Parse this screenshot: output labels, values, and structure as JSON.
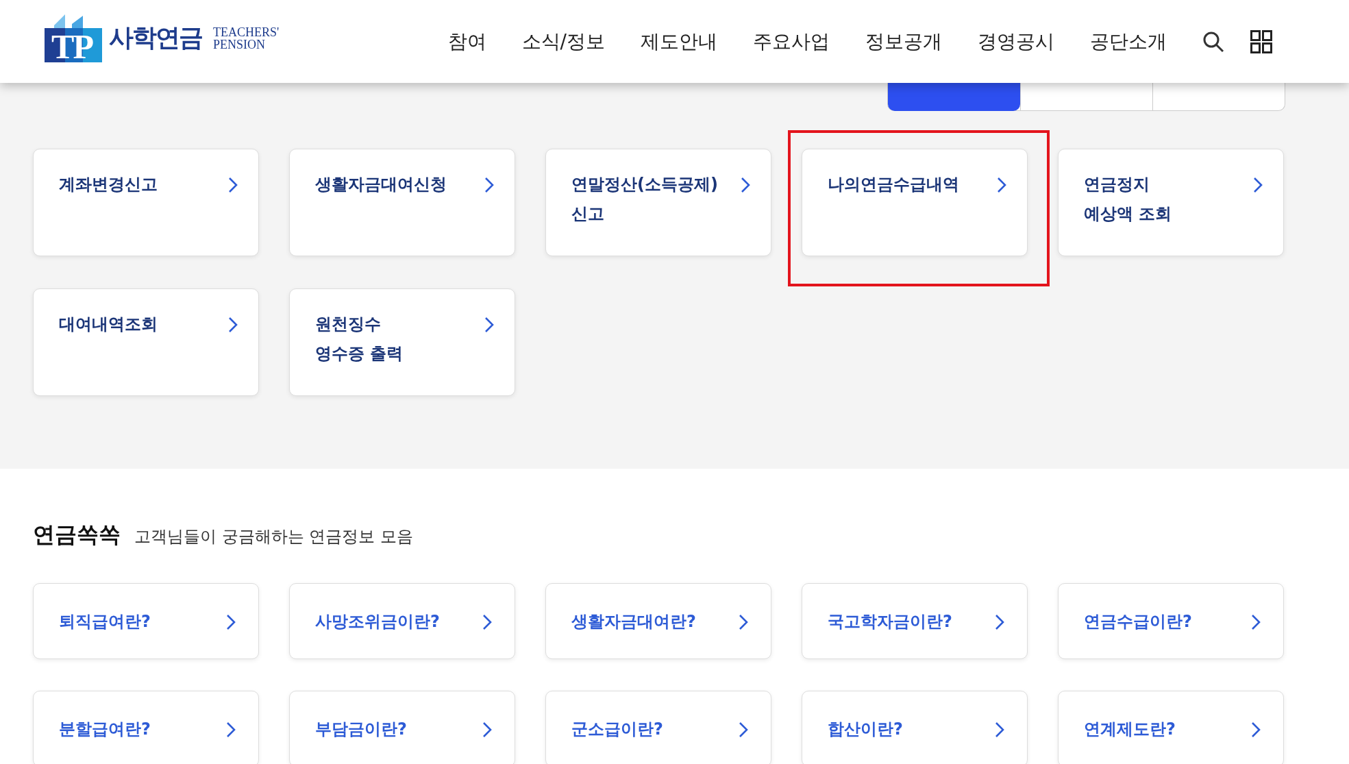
{
  "header": {
    "logo": {
      "mark": "TP",
      "name": "사학연금",
      "english_lines": [
        "TEACHERS'",
        "PENSION"
      ]
    },
    "nav": [
      "참여",
      "소식/정보",
      "제도안내",
      "주요사업",
      "정보공개",
      "경영공시",
      "공단소개"
    ]
  },
  "quick_menu": {
    "tabs": [
      {
        "selected": true
      },
      {
        "selected": false
      },
      {
        "selected": false
      }
    ],
    "cards": [
      {
        "label": "계좌변경신고",
        "highlighted": false
      },
      {
        "label": "생활자금대여신청",
        "highlighted": false
      },
      {
        "label": "연말정산(소득공제)\n신고",
        "highlighted": false
      },
      {
        "label": "나의연금수급내역",
        "highlighted": true
      },
      {
        "label": "연금정지\n예상액 조회",
        "highlighted": false
      },
      {
        "label": "대여내역조회",
        "highlighted": false
      },
      {
        "label": "원천징수\n영수증 출력",
        "highlighted": false
      }
    ]
  },
  "faq": {
    "title": "연금쏙쏙",
    "subtitle": "고객님들이 궁금해하는 연금정보 모음",
    "cards": [
      "퇴직급여란?",
      "사망조위금이란?",
      "생활자금대여란?",
      "국고학자금이란?",
      "연금수급이란?",
      "분할급여란?",
      "부담금이란?",
      "군소급이란?",
      "합산이란?",
      "연계제도란?"
    ]
  }
}
